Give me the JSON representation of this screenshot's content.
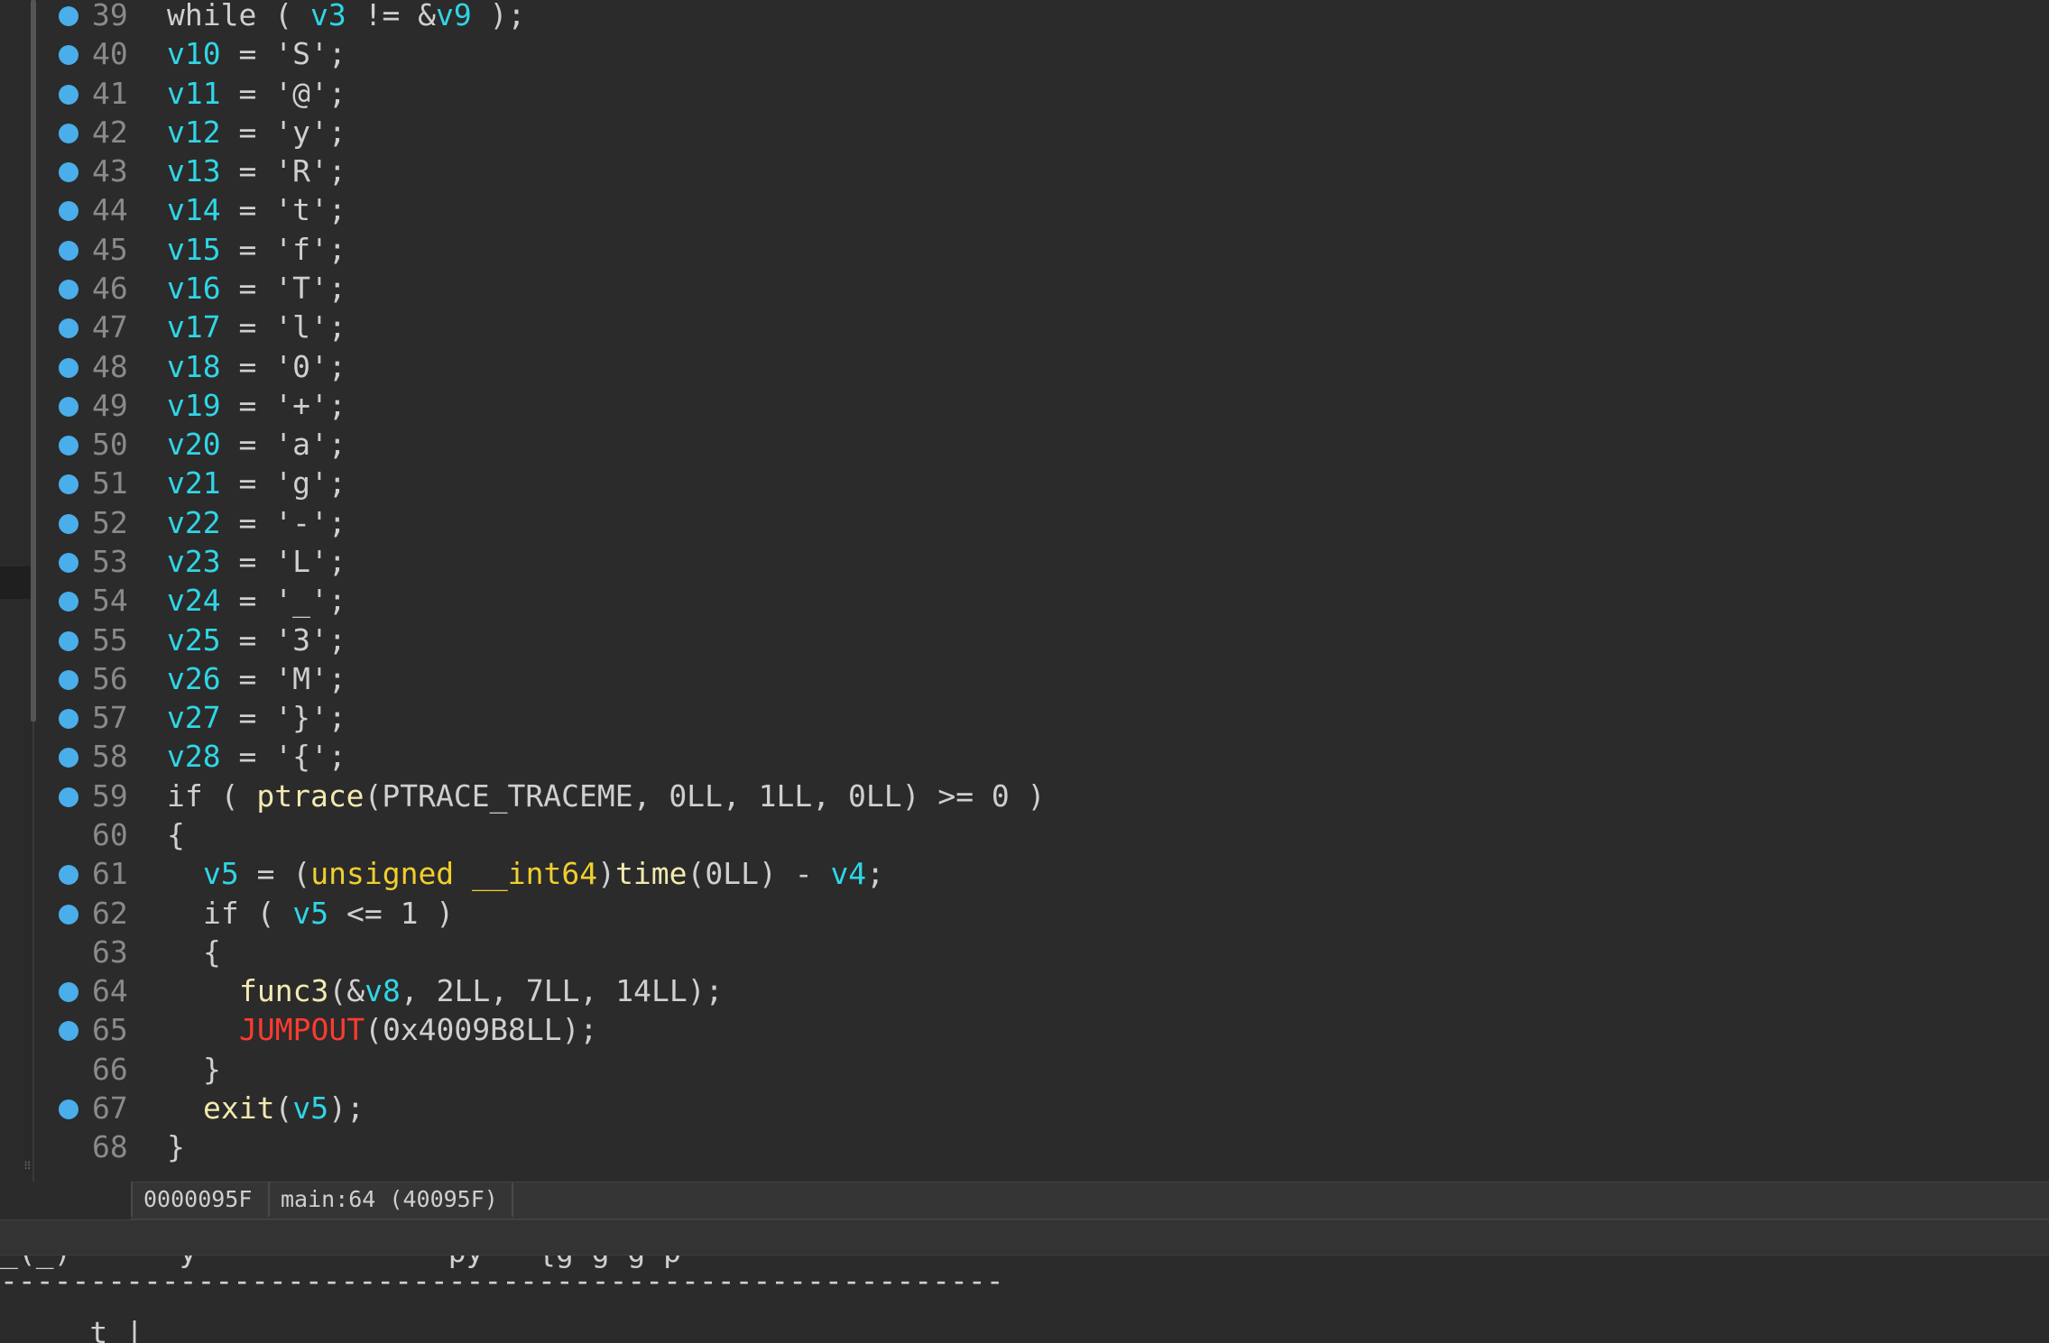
{
  "editor": {
    "lines": [
      {
        "num": "39",
        "bp": true,
        "indent": 0,
        "segs": [
          [
            "while ( ",
            "p"
          ],
          [
            "v3",
            "var"
          ],
          [
            " != &",
            "p"
          ],
          [
            "v9",
            "var"
          ],
          [
            " );",
            "p"
          ]
        ]
      },
      {
        "num": "40",
        "bp": true,
        "indent": 0,
        "segs": [
          [
            "v10",
            "var"
          ],
          [
            " = 'S';",
            "p"
          ]
        ]
      },
      {
        "num": "41",
        "bp": true,
        "indent": 0,
        "segs": [
          [
            "v11",
            "var"
          ],
          [
            " = '@';",
            "p"
          ]
        ]
      },
      {
        "num": "42",
        "bp": true,
        "indent": 0,
        "segs": [
          [
            "v12",
            "var"
          ],
          [
            " = 'y';",
            "p"
          ]
        ]
      },
      {
        "num": "43",
        "bp": true,
        "indent": 0,
        "segs": [
          [
            "v13",
            "var"
          ],
          [
            " = 'R';",
            "p"
          ]
        ]
      },
      {
        "num": "44",
        "bp": true,
        "indent": 0,
        "segs": [
          [
            "v14",
            "var"
          ],
          [
            " = 't';",
            "p"
          ]
        ]
      },
      {
        "num": "45",
        "bp": true,
        "indent": 0,
        "segs": [
          [
            "v15",
            "var"
          ],
          [
            " = 'f';",
            "p"
          ]
        ]
      },
      {
        "num": "46",
        "bp": true,
        "indent": 0,
        "segs": [
          [
            "v16",
            "var"
          ],
          [
            " = 'T';",
            "p"
          ]
        ]
      },
      {
        "num": "47",
        "bp": true,
        "indent": 0,
        "segs": [
          [
            "v17",
            "var"
          ],
          [
            " = 'l';",
            "p"
          ]
        ]
      },
      {
        "num": "48",
        "bp": true,
        "indent": 0,
        "segs": [
          [
            "v18",
            "var"
          ],
          [
            " = '0';",
            "p"
          ]
        ]
      },
      {
        "num": "49",
        "bp": true,
        "indent": 0,
        "segs": [
          [
            "v19",
            "var"
          ],
          [
            " = '+';",
            "p"
          ]
        ]
      },
      {
        "num": "50",
        "bp": true,
        "indent": 0,
        "segs": [
          [
            "v20",
            "var"
          ],
          [
            " = 'a';",
            "p"
          ]
        ]
      },
      {
        "num": "51",
        "bp": true,
        "indent": 0,
        "segs": [
          [
            "v21",
            "var"
          ],
          [
            " = 'g';",
            "p"
          ]
        ]
      },
      {
        "num": "52",
        "bp": true,
        "indent": 0,
        "segs": [
          [
            "v22",
            "var"
          ],
          [
            " = '-';",
            "p"
          ]
        ]
      },
      {
        "num": "53",
        "bp": true,
        "indent": 0,
        "segs": [
          [
            "v23",
            "var"
          ],
          [
            " = 'L';",
            "p"
          ]
        ]
      },
      {
        "num": "54",
        "bp": true,
        "indent": 0,
        "segs": [
          [
            "v24",
            "var"
          ],
          [
            " = '_';",
            "p"
          ]
        ]
      },
      {
        "num": "55",
        "bp": true,
        "indent": 0,
        "segs": [
          [
            "v25",
            "var"
          ],
          [
            " = '3';",
            "p"
          ]
        ]
      },
      {
        "num": "56",
        "bp": true,
        "indent": 0,
        "segs": [
          [
            "v26",
            "var"
          ],
          [
            " = 'M';",
            "p"
          ]
        ]
      },
      {
        "num": "57",
        "bp": true,
        "indent": 0,
        "segs": [
          [
            "v27",
            "var"
          ],
          [
            " = '}';",
            "p"
          ]
        ]
      },
      {
        "num": "58",
        "bp": true,
        "indent": 0,
        "segs": [
          [
            "v28",
            "var"
          ],
          [
            " = '{';",
            "p"
          ]
        ]
      },
      {
        "num": "59",
        "bp": true,
        "indent": 0,
        "segs": [
          [
            "if ( ",
            "p"
          ],
          [
            "ptrace",
            "func"
          ],
          [
            "(PTRACE_TRACEME, 0LL, 1LL, 0LL) >= 0 )",
            "p"
          ]
        ]
      },
      {
        "num": "60",
        "bp": false,
        "indent": 0,
        "segs": [
          [
            "{",
            "p"
          ]
        ]
      },
      {
        "num": "61",
        "bp": true,
        "indent": 1,
        "segs": [
          [
            "v5",
            "var"
          ],
          [
            " = (",
            "p"
          ],
          [
            "unsigned __int64",
            "type"
          ],
          [
            ")",
            "p"
          ],
          [
            "time",
            "func"
          ],
          [
            "(0LL) - ",
            "p"
          ],
          [
            "v4",
            "var"
          ],
          [
            ";",
            "p"
          ]
        ]
      },
      {
        "num": "62",
        "bp": true,
        "indent": 1,
        "segs": [
          [
            "if ( ",
            "p"
          ],
          [
            "v5",
            "var"
          ],
          [
            " <= 1 )",
            "p"
          ]
        ]
      },
      {
        "num": "63",
        "bp": false,
        "indent": 1,
        "segs": [
          [
            "{",
            "p"
          ]
        ]
      },
      {
        "num": "64",
        "bp": true,
        "indent": 2,
        "segs": [
          [
            "func3",
            "func"
          ],
          [
            "(&",
            "p"
          ],
          [
            "v8",
            "var"
          ],
          [
            ", 2LL, 7LL, 14LL);",
            "p"
          ]
        ]
      },
      {
        "num": "65",
        "bp": true,
        "indent": 2,
        "segs": [
          [
            "JUMPOUT",
            "red"
          ],
          [
            "(0x4009B8LL);",
            "p"
          ]
        ]
      },
      {
        "num": "66",
        "bp": false,
        "indent": 1,
        "segs": [
          [
            "}",
            "p"
          ]
        ]
      },
      {
        "num": "67",
        "bp": true,
        "indent": 1,
        "segs": [
          [
            "exit",
            "func"
          ],
          [
            "(",
            "p"
          ],
          [
            "v5",
            "var"
          ],
          [
            ");",
            "p"
          ]
        ]
      },
      {
        "num": "68",
        "bp": false,
        "indent": 0,
        "segs": [
          [
            "}",
            "p"
          ]
        ]
      }
    ]
  },
  "status_bar": {
    "address": "0000095F",
    "location": "main:64 (40095F)"
  },
  "output": {
    "partial_line": "_(_)      y              py   {g g g p",
    "separator": "--------------------------------------------------------",
    "last_line": "     t |"
  },
  "colors": {
    "background": "#2b2b2b",
    "variable": "#2fd6e6",
    "function": "#f3e9b0",
    "type": "#f0cf2e",
    "macro_red": "#ff3b30",
    "breakpoint": "#4aaeea"
  },
  "icons": {
    "breakpoint": "breakpoint-dot-icon"
  }
}
